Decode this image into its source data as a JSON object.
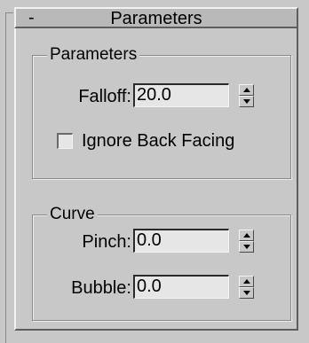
{
  "rollout": {
    "toggle": "-",
    "title": "Parameters"
  },
  "parameters_group": {
    "title": "Parameters",
    "falloff": {
      "label": "Falloff:",
      "value": "20.0"
    },
    "ignore_back_facing": {
      "label": "Ignore Back Facing",
      "checked": false
    }
  },
  "curve_group": {
    "title": "Curve",
    "pinch": {
      "label": "Pinch:",
      "value": "0.0"
    },
    "bubble": {
      "label": "Bubble:",
      "value": "0.0"
    }
  }
}
